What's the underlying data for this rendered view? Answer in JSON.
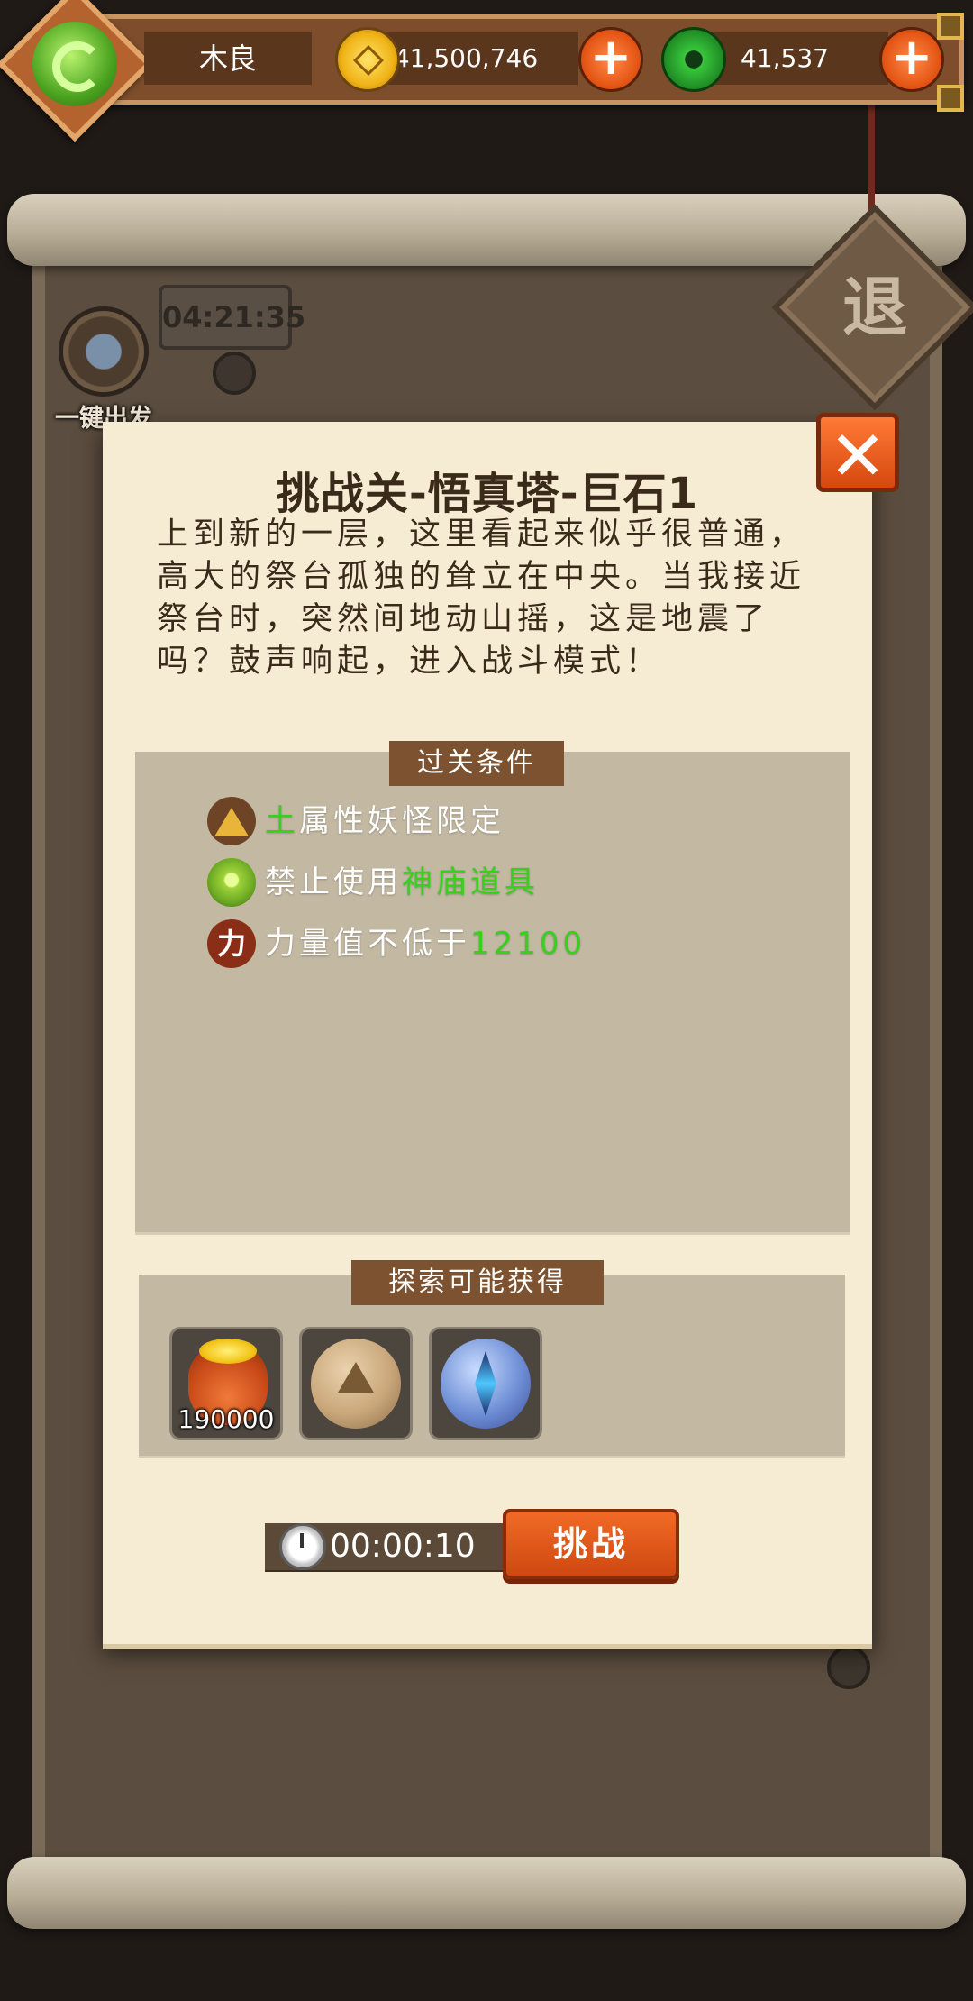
{
  "hud": {
    "player_name": "木良",
    "gold_amount": "41,500,746",
    "jade_amount": "41,537",
    "plus_symbol": "+"
  },
  "background": {
    "ghost_timer": "04:21:35",
    "one_click_depart_label": "一键出发",
    "exit_label": "退"
  },
  "dialog": {
    "title": "挑战关-悟真塔-巨石1",
    "close_symbol": "✕",
    "story": "上到新的一层，这里看起来似乎很普通，高大的祭台孤独的耸立在中央。当我接近祭台时，突然间地动山摇，这是地震了吗？鼓声响起，进入战斗模式！",
    "conditions_header": "过关条件",
    "conditions": [
      {
        "icon": "earth-element-icon",
        "highlight": "土",
        "text": "属性妖怪限定"
      },
      {
        "icon": "jade-ban-icon",
        "text": "禁止使用",
        "highlight": "神庙道具"
      },
      {
        "icon": "power-icon",
        "icon_glyph": "力",
        "text": "力量值不低于",
        "highlight": "12100"
      }
    ],
    "rewards_header": "探索可能获得",
    "rewards": [
      {
        "icon": "gold-bag-icon",
        "quantity": "190000"
      },
      {
        "icon": "stone-orb-icon"
      },
      {
        "icon": "crystal-orb-icon"
      }
    ],
    "timer": "00:00:10",
    "challenge_label": "挑战"
  },
  "colors": {
    "highlight_green": "#35d11b",
    "accent_orange": "#e45514",
    "panel_brown": "#7c5230"
  }
}
